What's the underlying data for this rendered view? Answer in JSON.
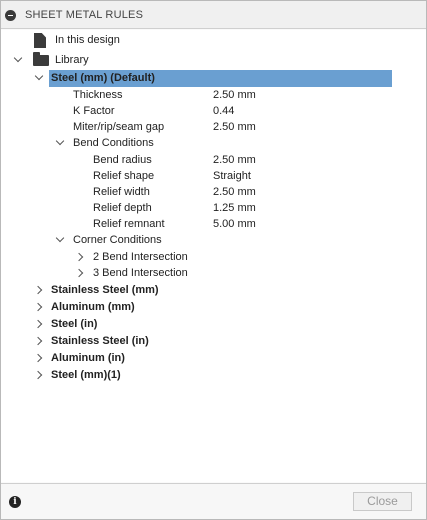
{
  "header": {
    "title": "SHEET METAL RULES"
  },
  "tree": {
    "in_this_design": "In this design",
    "library": "Library",
    "selected_rule": "Steel (mm) (Default)",
    "properties": [
      {
        "label": "Thickness",
        "value": "2.50 mm"
      },
      {
        "label": "K Factor",
        "value": "0.44"
      },
      {
        "label": "Miter/rip/seam gap",
        "value": "2.50 mm"
      }
    ],
    "bend_conditions": {
      "label": "Bend Conditions",
      "items": [
        {
          "label": "Bend radius",
          "value": "2.50 mm"
        },
        {
          "label": "Relief shape",
          "value": "Straight"
        },
        {
          "label": "Relief width",
          "value": "2.50 mm"
        },
        {
          "label": "Relief depth",
          "value": "1.25 mm"
        },
        {
          "label": "Relief remnant",
          "value": "5.00 mm"
        }
      ]
    },
    "corner_conditions": {
      "label": "Corner Conditions",
      "items": [
        {
          "label": "2 Bend Intersection"
        },
        {
          "label": "3 Bend Intersection"
        }
      ]
    },
    "other_rules": [
      "Stainless Steel (mm)",
      "Aluminum (mm)",
      "Steel (in)",
      "Stainless Steel (in)",
      "Aluminum (in)",
      "Steel (mm)(1)"
    ]
  },
  "footer": {
    "close_label": "Close"
  },
  "colors": {
    "selection": "#6a9fd1",
    "disabled_text": "#9a9a9a"
  }
}
